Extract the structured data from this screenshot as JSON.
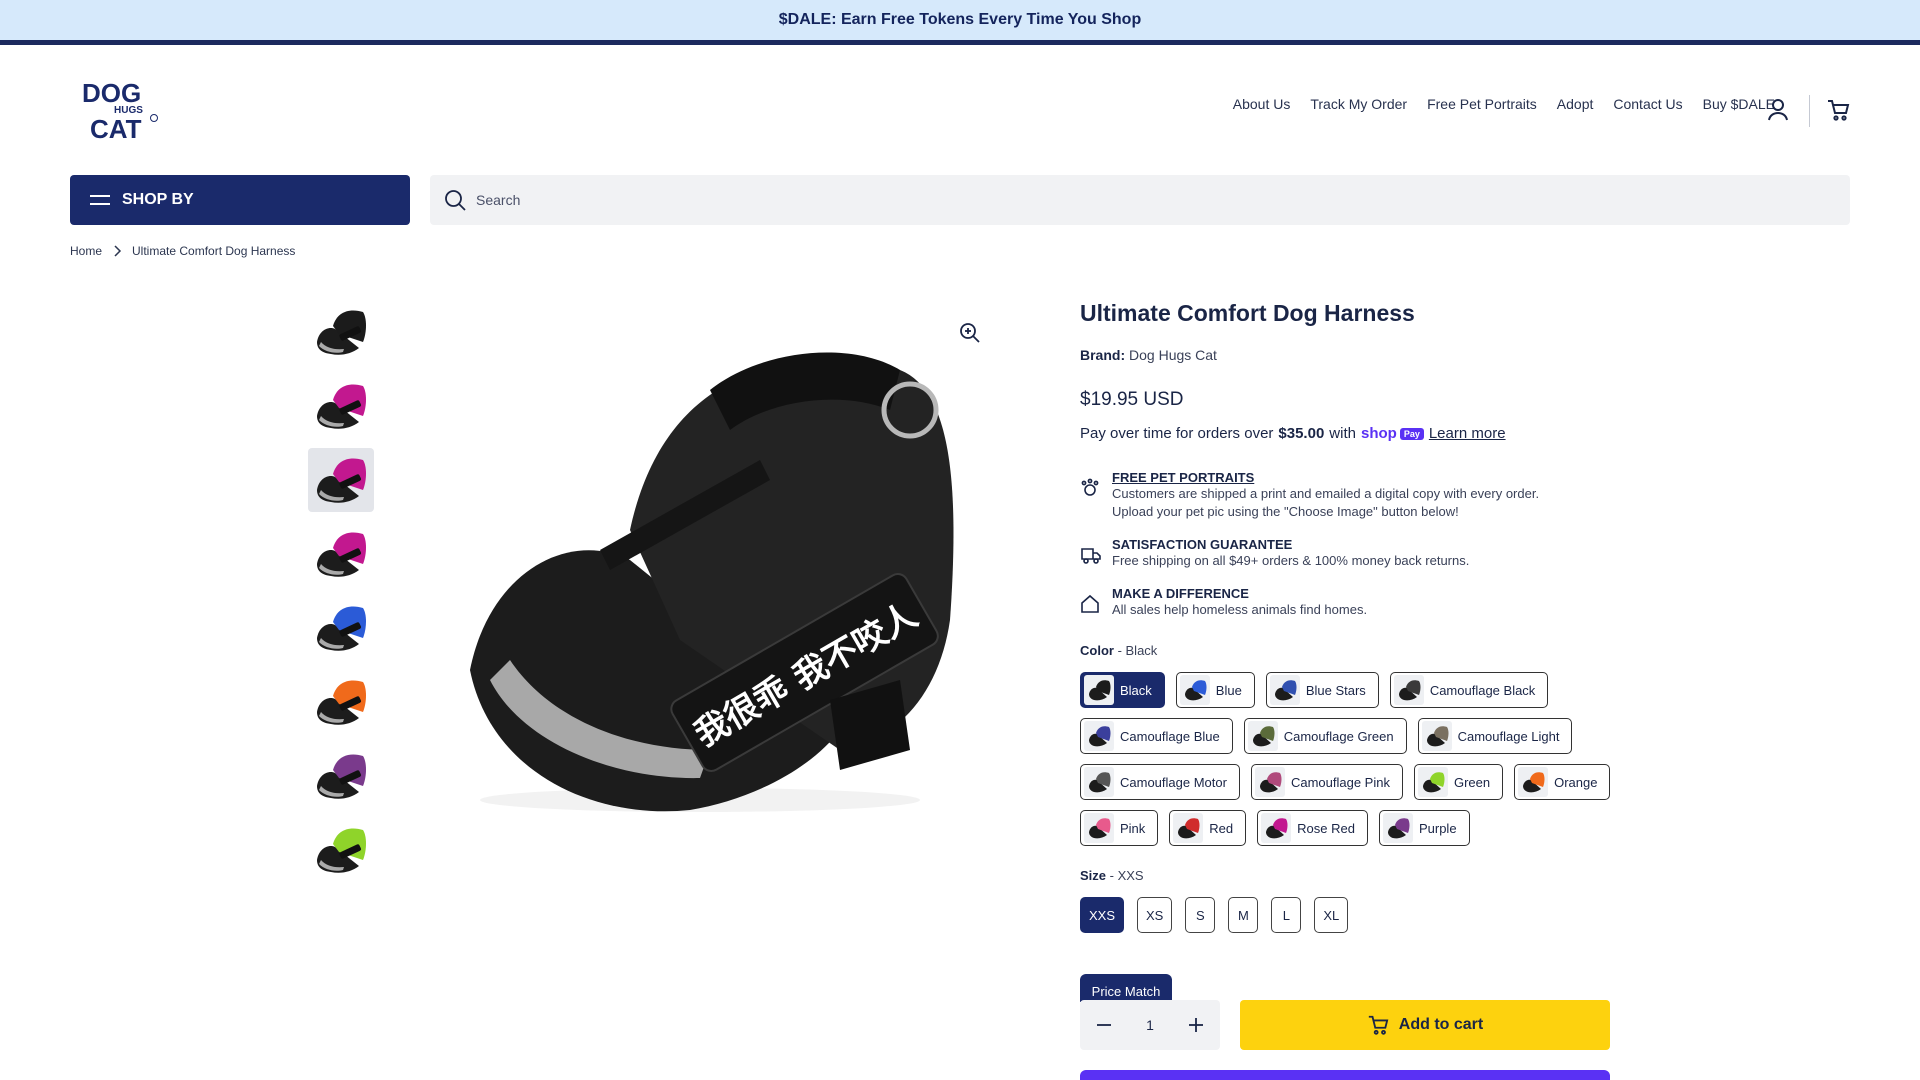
{
  "announcement": "$DALE: Earn Free Tokens Every Time You Shop",
  "logo": {
    "line1": "DOG",
    "line2": "HUGS",
    "line3": "CAT"
  },
  "nav": [
    "About Us",
    "Track My Order",
    "Free Pet Portraits",
    "Adopt",
    "Contact Us",
    "Buy $DALE"
  ],
  "header_icons": [
    "account-icon",
    "cart-icon"
  ],
  "shop_by_label": "SHOP BY",
  "search": {
    "placeholder": "Search"
  },
  "breadcrumb": {
    "home": "Home",
    "current": "Ultimate Comfort Dog Harness"
  },
  "gallery": {
    "thumbnail_colors": [
      "#1b1b1b",
      "#c2188f",
      "#c2188f",
      "#c2188f",
      "#2b5bd7",
      "#f06a1b",
      "#7a3a8c",
      "#8fd42a"
    ],
    "active_thumbnail": 2,
    "main_patch_text": "我很乖 我不咬人"
  },
  "product": {
    "title": "Ultimate Comfort Dog Harness",
    "brand_label": "Brand:",
    "brand": "Dog Hugs Cat",
    "price": "$19.95 USD",
    "pay_prefix": "Pay over time for orders over",
    "pay_amount": "$35.00",
    "pay_with": "with",
    "shop_pay_text": "shop",
    "shop_pay_badge": "Pay",
    "learn_more": "Learn more"
  },
  "features": [
    {
      "icon": "pet-icon",
      "heading": "FREE PET PORTRAITS",
      "lines": [
        "Customers are shipped a print and emailed a digital copy with every order.",
        "Upload your pet pic using the \"Choose Image\" button below!"
      ]
    },
    {
      "icon": "truck-icon",
      "heading": "SATISFACTION GUARANTEE",
      "lines": [
        "Free shipping on all $49+ orders & 100% money back returns."
      ]
    },
    {
      "icon": "home-icon",
      "heading": "MAKE A DIFFERENCE",
      "lines": [
        "All sales help homeless animals find homes."
      ]
    }
  ],
  "color_option": {
    "label": "Color",
    "selected": "Black",
    "choices": [
      {
        "name": "Black",
        "color": "#1b1b1b"
      },
      {
        "name": "Blue",
        "color": "#2b5bd7"
      },
      {
        "name": "Blue Stars",
        "color": "#3050b0"
      },
      {
        "name": "Camouflage Black",
        "color": "#3a3a3a"
      },
      {
        "name": "Camouflage Blue",
        "color": "#3b3f9c"
      },
      {
        "name": "Camouflage Green",
        "color": "#5b6b3a"
      },
      {
        "name": "Camouflage Light",
        "color": "#7a7060"
      },
      {
        "name": "Camouflage Motor",
        "color": "#555555"
      },
      {
        "name": "Camouflage Pink",
        "color": "#b04a7c"
      },
      {
        "name": "Green",
        "color": "#8fd42a"
      },
      {
        "name": "Orange",
        "color": "#f06a1b"
      },
      {
        "name": "Pink",
        "color": "#e85a8c"
      },
      {
        "name": "Red",
        "color": "#d02c2c"
      },
      {
        "name": "Rose Red",
        "color": "#c2188f"
      },
      {
        "name": "Purple",
        "color": "#7a3a8c"
      }
    ]
  },
  "size_option": {
    "label": "Size",
    "selected": "XXS",
    "choices": [
      "XXS",
      "XS",
      "S",
      "M",
      "L",
      "XL"
    ]
  },
  "price_match_label": "Price Match",
  "quantity": "1",
  "add_to_cart_label": "Add to cart",
  "colors": {
    "navy": "#1a2a6b",
    "yellow": "#fdd20e",
    "shop_purple": "#5a31f4",
    "banner": "#d6e9fb"
  }
}
